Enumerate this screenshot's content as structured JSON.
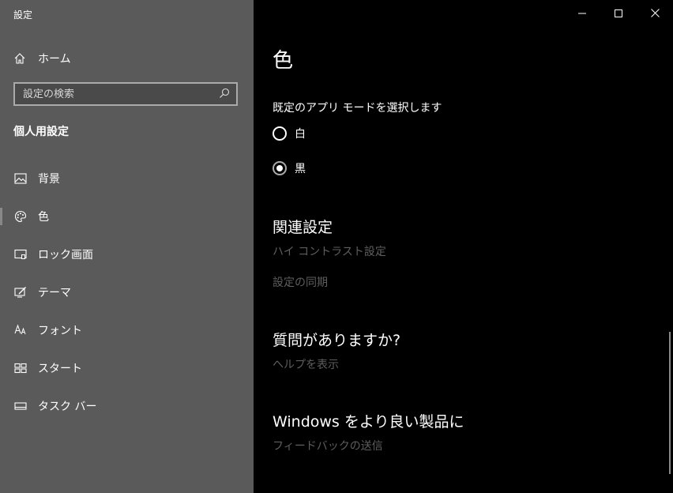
{
  "sidebar": {
    "app_title": "設定",
    "home_label": "ホーム",
    "search_placeholder": "設定の検索",
    "section_title": "個人用設定",
    "items": [
      {
        "label": "背景",
        "icon": "picture-icon"
      },
      {
        "label": "色",
        "icon": "palette-icon"
      },
      {
        "label": "ロック画面",
        "icon": "lock-screen-icon"
      },
      {
        "label": "テーマ",
        "icon": "theme-icon"
      },
      {
        "label": "フォント",
        "icon": "font-icon"
      },
      {
        "label": "スタート",
        "icon": "start-icon"
      },
      {
        "label": "タスク バー",
        "icon": "taskbar-icon"
      }
    ]
  },
  "main": {
    "title": "色",
    "mode_label": "既定のアプリ モードを選択します",
    "options": [
      {
        "label": "白",
        "checked": false
      },
      {
        "label": "黒",
        "checked": true
      }
    ],
    "related_heading": "関連設定",
    "related_links": [
      "ハイ コントラスト設定",
      "設定の同期"
    ],
    "question_heading": "質問がありますか?",
    "question_link": "ヘルプを表示",
    "feedback_heading": "Windows をより良い製品に",
    "feedback_link": "フィードバックの送信"
  },
  "colors": {
    "sidebar_bg": "#5a5a5a",
    "main_bg": "#000000",
    "link_disabled": "#5e5e5e"
  }
}
